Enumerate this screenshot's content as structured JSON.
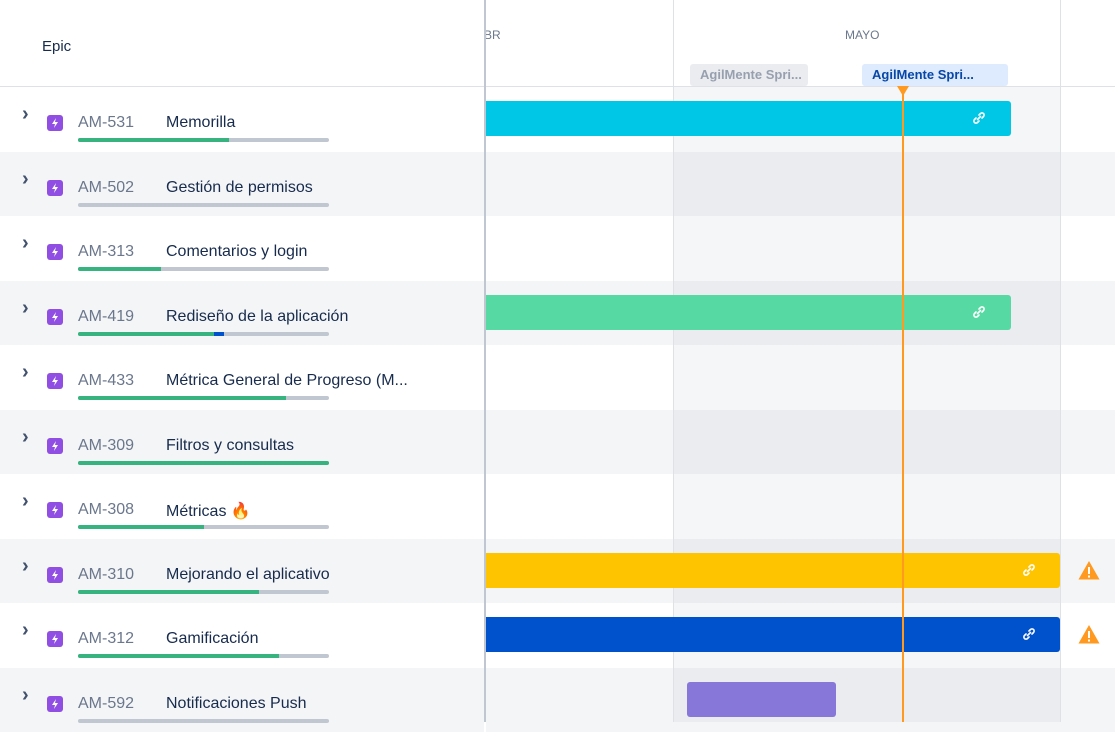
{
  "header": {
    "epic_label": "Epic",
    "month_prev": "BR",
    "month": "MAYO"
  },
  "sprints": [
    {
      "name": "AgilMente Spri...",
      "state": "past"
    },
    {
      "name": "AgilMente Spri...",
      "state": "current"
    }
  ],
  "colors": {
    "accent": "#ff991f",
    "epic_icon": "#904ee2"
  },
  "epics": [
    {
      "key": "AM-531",
      "summary": "Memorilla",
      "progress_done": 0.6,
      "progress_inprogress": 0,
      "bar_color": "#00c7e6",
      "has_bar": true,
      "warning": false
    },
    {
      "key": "AM-502",
      "summary": "Gestión de permisos",
      "progress_done": 0,
      "progress_inprogress": 0,
      "has_bar": false,
      "warning": false
    },
    {
      "key": "AM-313",
      "summary": "Comentarios y login",
      "progress_done": 0.33,
      "progress_inprogress": 0,
      "has_bar": false,
      "warning": false
    },
    {
      "key": "AM-419",
      "summary": "Rediseño de la aplicación",
      "progress_done": 0.54,
      "progress_inprogress": 0.04,
      "bar_color": "#57d9a3",
      "has_bar": true,
      "warning": false
    },
    {
      "key": "AM-433",
      "summary": "Métrica General de Progreso (M...",
      "progress_done": 0.83,
      "progress_inprogress": 0,
      "has_bar": false,
      "warning": false
    },
    {
      "key": "AM-309",
      "summary": "Filtros y consultas",
      "progress_done": 1.0,
      "progress_inprogress": 0,
      "has_bar": false,
      "warning": false
    },
    {
      "key": "AM-308",
      "summary": "Métricas 🔥",
      "progress_done": 0.5,
      "progress_inprogress": 0,
      "has_bar": false,
      "warning": false
    },
    {
      "key": "AM-310",
      "summary": "Mejorando el aplicativo",
      "progress_done": 0.72,
      "progress_inprogress": 0,
      "bar_color": "#ffc400",
      "has_bar": true,
      "warning": true
    },
    {
      "key": "AM-312",
      "summary": "Gamificación",
      "progress_done": 0.8,
      "progress_inprogress": 0,
      "bar_color": "#0052cc",
      "has_bar": true,
      "warning": true
    },
    {
      "key": "AM-592",
      "summary": "Notificaciones Push",
      "progress_done": 0,
      "progress_inprogress": 0,
      "bar_color": "#8777d9",
      "has_bar": true,
      "warning": false
    }
  ]
}
